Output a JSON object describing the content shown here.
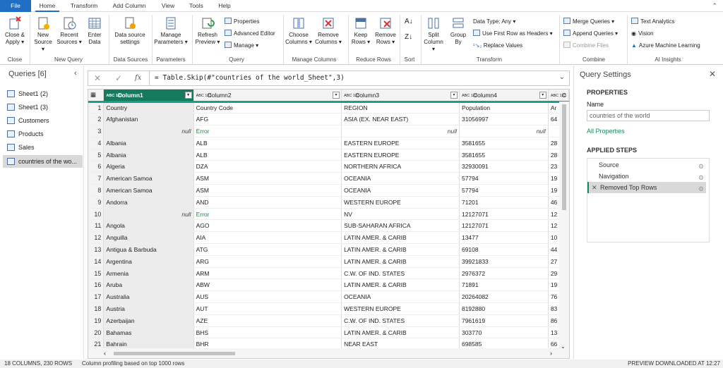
{
  "tabs": [
    "File",
    "Home",
    "Transform",
    "Add Column",
    "View",
    "Tools",
    "Help"
  ],
  "ribbon": {
    "close_apply": "Close &",
    "close_apply2": "Apply",
    "new_source": "New",
    "new_source2": "Source",
    "recent_sources": "Recent",
    "recent_sources2": "Sources",
    "enter_data": "Enter",
    "enter_data2": "Data",
    "data_source_settings": "Data source",
    "data_source_settings2": "settings",
    "manage_parameters": "Manage",
    "manage_parameters2": "Parameters",
    "refresh_preview": "Refresh",
    "refresh_preview2": "Preview",
    "properties": "Properties",
    "advanced_editor": "Advanced Editor",
    "manage": "Manage",
    "choose_columns": "Choose",
    "choose_columns2": "Columns",
    "remove_columns": "Remove",
    "remove_columns2": "Columns",
    "keep_rows": "Keep",
    "keep_rows2": "Rows",
    "remove_rows": "Remove",
    "remove_rows2": "Rows",
    "split_column": "Split",
    "split_column2": "Column",
    "group_by": "Group",
    "group_by2": "By",
    "data_type": "Data Type: Any",
    "first_row_headers": "Use First Row as Headers",
    "replace_values": "Replace Values",
    "merge_queries": "Merge Queries",
    "append_queries": "Append Queries",
    "combine_files": "Combine Files",
    "text_analytics": "Text Analytics",
    "vision": "Vision",
    "azure_ml": "Azure Machine Learning",
    "groups": {
      "close": "Close",
      "new_query": "New Query",
      "data_sources": "Data Sources",
      "parameters": "Parameters",
      "query": "Query",
      "manage_columns": "Manage Columns",
      "reduce_rows": "Reduce Rows",
      "sort": "Sort",
      "transform": "Transform",
      "combine": "Combine",
      "ai_insights": "AI Insights"
    }
  },
  "queries_pane": {
    "title": "Queries [6]",
    "items": [
      "Sheet1 (2)",
      "Sheet1 (3)",
      "Customers",
      "Products",
      "Sales",
      "countries of the wo..."
    ]
  },
  "formula": "= Table.Skip(#\"countries of the world_Sheet\",3)",
  "grid": {
    "columns": [
      "Column1",
      "Column2",
      "Column3",
      "Column4",
      "C"
    ],
    "rows": [
      [
        "1",
        "Country",
        "Country Code",
        "REGION",
        "Population",
        "Ar"
      ],
      [
        "2",
        "Afghanistan",
        "AFG",
        "ASIA (EX. NEAR EAST)",
        "31056997",
        "64"
      ],
      [
        "3",
        "null",
        "Error",
        "null",
        "null",
        ""
      ],
      [
        "4",
        "Albania",
        "ALB",
        "EASTERN EUROPE",
        "3581655",
        "28"
      ],
      [
        "5",
        "Albania",
        "ALB",
        "EASTERN EUROPE",
        "3581655",
        "28"
      ],
      [
        "6",
        "Algeria",
        "DZA",
        "NORTHERN AFRICA",
        "32930091",
        "23"
      ],
      [
        "7",
        "American Samoa",
        "ASM",
        "OCEANIA",
        "57794",
        "19"
      ],
      [
        "8",
        "American Samoa",
        "ASM",
        "OCEANIA",
        "57794",
        "19"
      ],
      [
        "9",
        "Andorra",
        "AND",
        "WESTERN EUROPE",
        "71201",
        "46"
      ],
      [
        "10",
        "null",
        "Error",
        "NV",
        "12127071",
        "12"
      ],
      [
        "11",
        "Angola",
        "AGO",
        "SUB-SAHARAN AFRICA",
        "12127071",
        "12"
      ],
      [
        "12",
        "Anguilla",
        "AIA",
        "LATIN AMER. & CARIB",
        "13477",
        "10"
      ],
      [
        "13",
        "Antigua & Barbuda",
        "ATG",
        "LATIN AMER. & CARIB",
        "69108",
        "44"
      ],
      [
        "14",
        "Argentina",
        "ARG",
        "LATIN AMER. & CARIB",
        "39921833",
        "27"
      ],
      [
        "15",
        "Armenia",
        "ARM",
        "C.W. OF IND. STATES",
        "2976372",
        "29"
      ],
      [
        "16",
        "Aruba",
        "ABW",
        "LATIN AMER. & CARIB",
        "71891",
        "19"
      ],
      [
        "17",
        "Australia",
        "AUS",
        "OCEANIA",
        "20264082",
        "76"
      ],
      [
        "18",
        "Austria",
        "AUT",
        "WESTERN EUROPE",
        "8192880",
        "83"
      ],
      [
        "19",
        "Azerbaijan",
        "AZE",
        "C.W. OF IND. STATES",
        "7961619",
        "86"
      ],
      [
        "20",
        "Bahamas",
        "BHS",
        "LATIN AMER. & CARIB",
        "303770",
        "13"
      ],
      [
        "21",
        "Bahrain",
        "BHR",
        "NEAR EAST",
        "698585",
        "66"
      ]
    ]
  },
  "settings": {
    "title": "Query Settings",
    "properties": "PROPERTIES",
    "name_label": "Name",
    "name_value": "countries of the world",
    "all_properties": "All Properties",
    "applied_steps": "APPLIED STEPS",
    "steps": [
      "Source",
      "Navigation",
      "Removed Top Rows"
    ]
  },
  "status": {
    "left": "18 COLUMNS, 230 ROWS",
    "profiling": "Column profiling based on top 1000 rows",
    "right": "PREVIEW DOWNLOADED AT 12:27"
  }
}
